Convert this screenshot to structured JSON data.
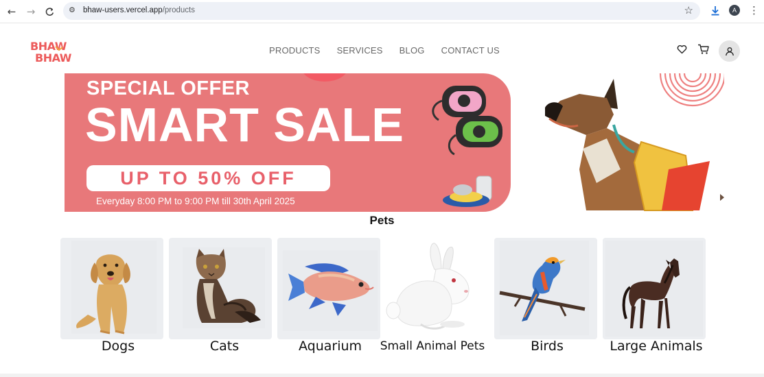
{
  "browser": {
    "url_host": "bhaw-users.vercel.app",
    "url_path": "/products",
    "account_initial": "A"
  },
  "site": {
    "logo_text": "BHAW BHAW",
    "nav": [
      "PRODUCTS",
      "SERVICES",
      "BLOG",
      "CONTACT US"
    ]
  },
  "banner": {
    "offer": "SPECIAL OFFER",
    "headline": "SMART SALE",
    "discount": "UP TO 50% OFF",
    "schedule": "Everyday 8:00 PM to 9:00 PM till 30th April 2025"
  },
  "pets": {
    "title": "Pets",
    "categories": [
      "Dogs",
      "Cats",
      "Aquarium",
      "Small Animal Pets",
      "Birds",
      "Large Animals"
    ]
  },
  "colors": {
    "banner_pink": "#e8787a",
    "brand_red": "#ec5a5a",
    "card_bg": "#eceef1"
  }
}
